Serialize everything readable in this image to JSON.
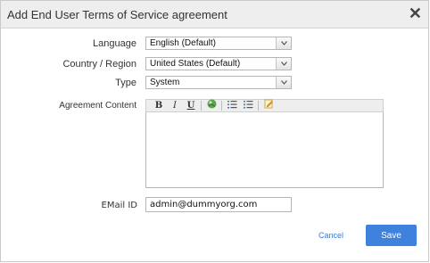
{
  "dialog": {
    "title": "Add End User Terms of Service agreement",
    "close_glyph": "✕"
  },
  "form": {
    "language": {
      "label": "Language",
      "value": "English (Default)"
    },
    "country": {
      "label": "Country / Region",
      "value": "United States (Default)"
    },
    "type": {
      "label": "Type",
      "value": "System"
    },
    "agreement": {
      "label": "Agreement Content",
      "content": "",
      "toolbar": {
        "bold": "B",
        "italic": "I",
        "underline": "U",
        "icons": [
          "bold-icon",
          "italic-icon",
          "underline-icon",
          "insert-image-icon",
          "ordered-list-icon",
          "unordered-list-icon",
          "edit-html-icon"
        ]
      }
    },
    "email": {
      "label": "EMail ID",
      "value": "admin@dummyorg.com"
    }
  },
  "actions": {
    "cancel_label": "Cancel",
    "save_label": "Save"
  },
  "colors": {
    "accent": "#3e82de",
    "link": "#3b7ad9",
    "titlebar": "#eeeeee"
  }
}
